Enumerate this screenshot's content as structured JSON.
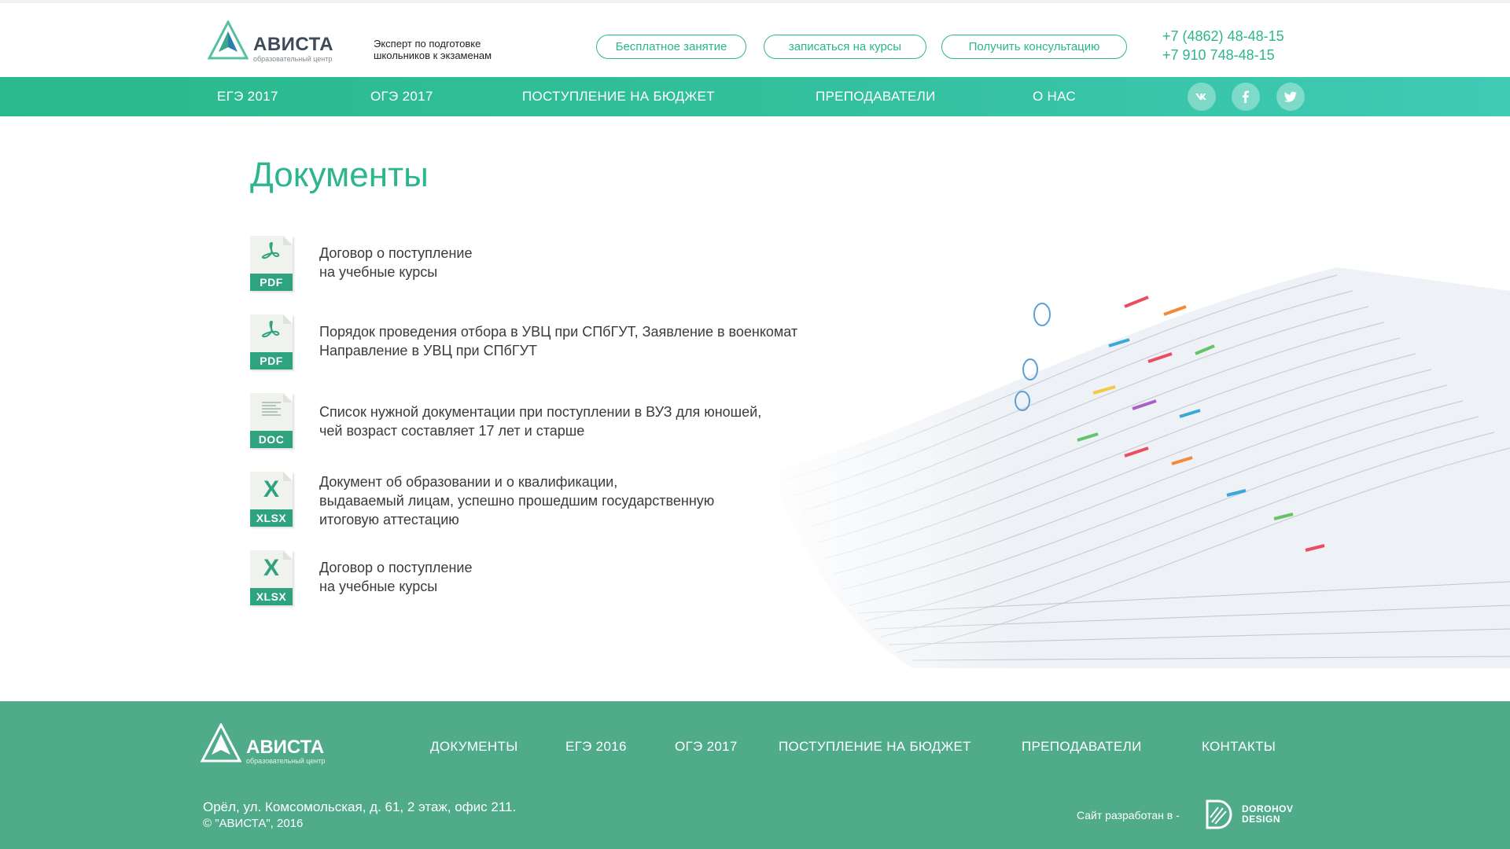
{
  "header": {
    "brand": "АВИСТА",
    "brand_sub": "образовательный центр",
    "tagline": "Эксперт по подготовке школьников к экзаменам",
    "buttons": [
      "Бесплатное занятие",
      "записаться на курсы",
      "Получить консультацию"
    ],
    "phones": [
      "+7 (4862) 48-48-15",
      "+7 910 748-48-15"
    ]
  },
  "nav": {
    "items": [
      "ЕГЭ 2017",
      "ОГЭ 2017",
      "ПОСТУПЛЕНИЕ НА БЮДЖЕТ",
      "ПРЕПОДАВАТЕЛИ",
      "О НАС"
    ],
    "social": [
      "vk-icon",
      "facebook-icon",
      "twitter-icon"
    ]
  },
  "main": {
    "title": "Документы",
    "documents": [
      {
        "type": "PDF",
        "text": "Договор о поступление\nна учебные курсы"
      },
      {
        "type": "PDF",
        "text": "Порядок проведения отбора в УВЦ при СПбГУТ, Заявление в военкомат\nНаправление в УВЦ при СПбГУТ"
      },
      {
        "type": "DOC",
        "text": "Список нужной документации при поступлении в ВУЗ для юношей,\nчей возраст составляет 17 лет и старше"
      },
      {
        "type": "XLSX",
        "text": "Документ об образовании и о квалификации,\nвыдаваемый лицам, успешно прошедшим государственную\nитоговую аттестацию"
      },
      {
        "type": "XLSX",
        "text": "Договор о поступление\nна учебные курсы"
      }
    ]
  },
  "footer": {
    "brand": "АВИСТА",
    "brand_sub": "образовательный центр",
    "nav": [
      "ДОКУМЕНТЫ",
      "ЕГЭ 2016",
      "ОГЭ 2017",
      "ПОСТУПЛЕНИЕ НА БЮДЖЕТ",
      "ПРЕПОДАВАТЕЛИ",
      "КОНТАКТЫ"
    ],
    "address": "Орёл, ул. Комсомольская, д. 61, 2 этаж, офис 211.",
    "copyright": "© \"АВИСТА\", 2016",
    "developer_label": "Сайт разработан в -",
    "developer_name_1": "DOROHOV",
    "developer_name_2": "DESIGN"
  },
  "colors": {
    "accent": "#2db58d",
    "footer_bg": "#4fab8a",
    "nav_from": "#29b98a",
    "nav_to": "#3fcbb5"
  }
}
